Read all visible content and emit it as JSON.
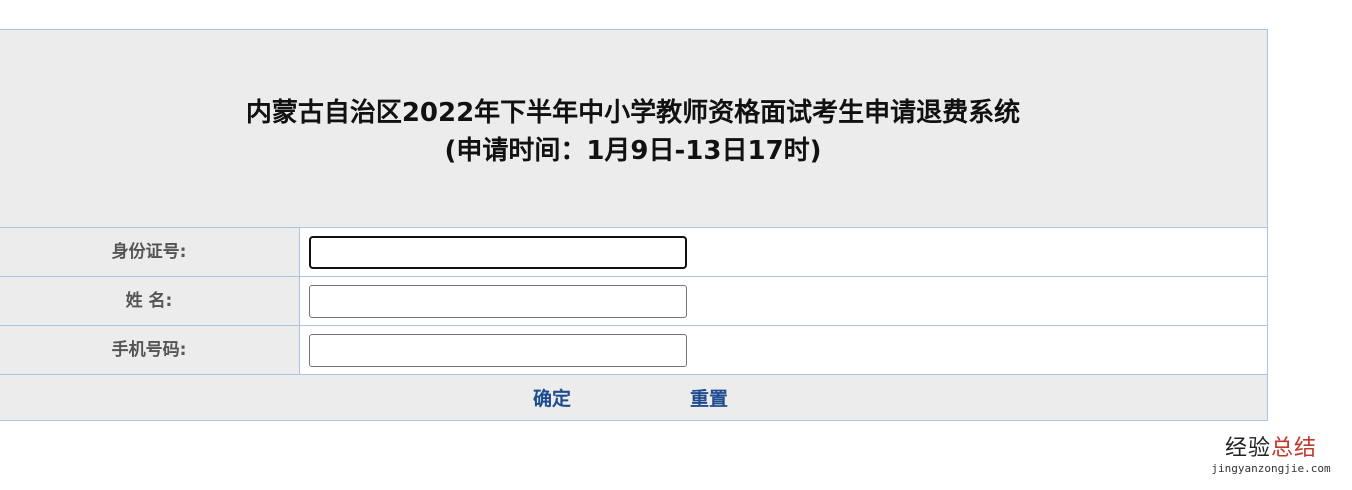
{
  "header": {
    "title_line1": "内蒙古自治区2022年下半年中小学教师资格面试考生申请退费系统",
    "title_line2": "(申请时间：1月9日-13日17时)"
  },
  "form": {
    "fields": [
      {
        "label": "身份证号:",
        "value": ""
      },
      {
        "label": "姓 名:",
        "value": ""
      },
      {
        "label": "手机号码:",
        "value": ""
      }
    ]
  },
  "actions": {
    "confirm_label": "确定",
    "reset_label": "重置"
  },
  "watermark": {
    "text_main": "经验",
    "text_accent": "总结",
    "url": "jingyanzongjie.com"
  },
  "colors": {
    "header_bg": "#ececec",
    "border": "#a9c3e0",
    "link": "#1f4b8f",
    "label_text": "#555555"
  }
}
